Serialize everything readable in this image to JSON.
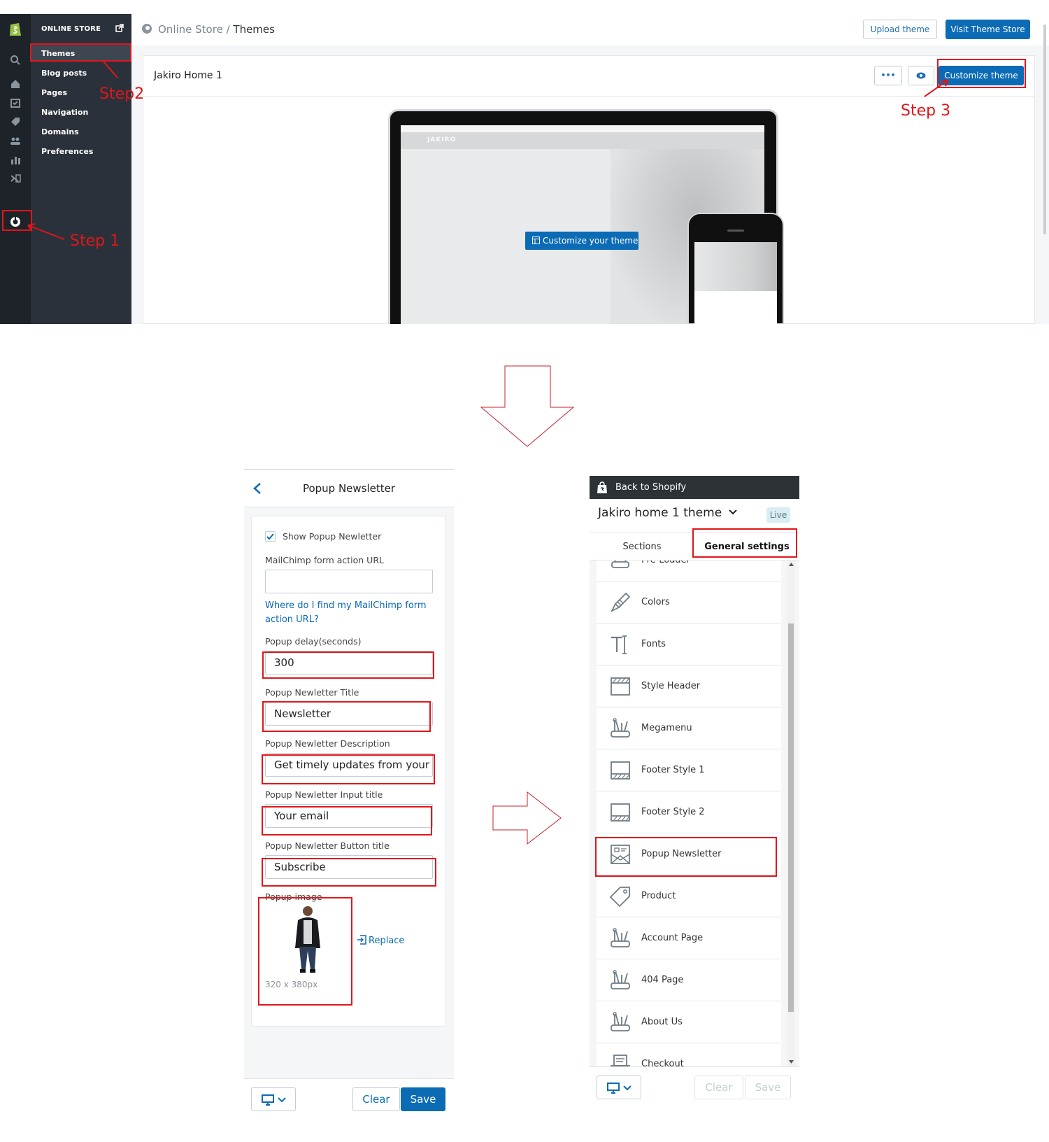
{
  "admin": {
    "sidebar": {
      "heading": "ONLINE STORE",
      "items": [
        {
          "label": "Themes"
        },
        {
          "label": "Blog posts"
        },
        {
          "label": "Pages"
        },
        {
          "label": "Navigation"
        },
        {
          "label": "Domains"
        },
        {
          "label": "Preferences"
        }
      ],
      "rail_icons": [
        "search-icon",
        "home-icon",
        "orders-icon",
        "products-icon",
        "customers-icon",
        "analytics-icon",
        "discounts-icon",
        "online-store-icon"
      ]
    },
    "breadcrumb": {
      "parent": "Online Store",
      "separator": " / ",
      "current": "Themes"
    },
    "buttons": {
      "upload": "Upload theme",
      "visit": "Visit Theme Store",
      "customize": "Customize theme",
      "more": "•••"
    },
    "theme_name": "Jakiro Home 1",
    "preview": {
      "customize_label": "Customize your theme",
      "logo": "JAKIRO"
    },
    "annotations": {
      "step1": "Step 1",
      "step2": "Step2",
      "step3": "Step 3"
    }
  },
  "popup": {
    "title": "Popup Newsletter",
    "show_label": "Show Popup Newletter",
    "show_checked": true,
    "mailchimp_label": "MailChimp form action URL",
    "mailchimp_value": "",
    "mailchimp_help": "Where do I find my MailChimp form action URL?",
    "delay_label": "Popup delay(seconds)",
    "delay_value": "300",
    "title_label": "Popup Newletter Title",
    "title_value": "Newsletter",
    "desc_label": "Popup Newletter Description",
    "desc_value": "Get timely updates from your f",
    "input_label": "Popup Newletter Input title",
    "input_value": "Your email",
    "button_label": "Popup Newletter Button title",
    "button_value": "Subscribe",
    "image_label": "Popup image",
    "image_size": "320 x 380px",
    "replace": "Replace",
    "clear": "Clear",
    "save": "Save"
  },
  "settings": {
    "back": "Back to Shopify",
    "theme_title": "Jakiro home 1 theme",
    "badge": "Live",
    "tabs": {
      "sections": "Sections",
      "general": "General settings"
    },
    "items": [
      {
        "label": "Pre-Loader",
        "icon": "preloader-icon"
      },
      {
        "label": "Colors",
        "icon": "brush-icon"
      },
      {
        "label": "Fonts",
        "icon": "text-icon"
      },
      {
        "label": "Style Header",
        "icon": "header-icon"
      },
      {
        "label": "Megamenu",
        "icon": "tools-icon"
      },
      {
        "label": "Footer Style 1",
        "icon": "footer-icon"
      },
      {
        "label": "Footer Style 2",
        "icon": "footer-icon"
      },
      {
        "label": "Popup Newsletter",
        "icon": "newsletter-icon"
      },
      {
        "label": "Product",
        "icon": "tag-icon"
      },
      {
        "label": "Account Page",
        "icon": "tools-icon"
      },
      {
        "label": "404 Page",
        "icon": "tools-icon"
      },
      {
        "label": "About Us",
        "icon": "tools-icon"
      },
      {
        "label": "Checkout",
        "icon": "register-icon"
      }
    ],
    "clear": "Clear",
    "save": "Save"
  },
  "colors": {
    "accent": "#0b6bb5",
    "annotation": "#e0161b",
    "sidebar": "#2b313a",
    "rail": "#1e2329"
  }
}
